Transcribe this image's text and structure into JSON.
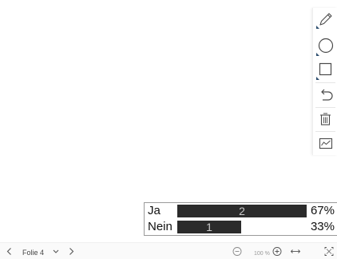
{
  "toolbar": {
    "tools": [
      {
        "name": "pencil-tool",
        "icon": "pencil-icon",
        "has_submenu": true
      },
      {
        "name": "ellipse-tool",
        "icon": "circle-icon",
        "has_submenu": true
      },
      {
        "name": "rectangle-tool",
        "icon": "square-icon",
        "has_submenu": true
      },
      {
        "name": "undo-tool",
        "icon": "undo-icon",
        "has_submenu": false
      },
      {
        "name": "delete-tool",
        "icon": "trash-icon",
        "has_submenu": false
      },
      {
        "name": "chart-tool",
        "icon": "line-chart-icon",
        "has_submenu": false
      }
    ]
  },
  "results": {
    "rows": [
      {
        "label": "Ja",
        "count": "2",
        "percent": "67%",
        "fraction": 0.67
      },
      {
        "label": "Nein",
        "count": "1",
        "percent": "33%",
        "fraction": 0.33
      }
    ],
    "bar_color": "#2b2b2b"
  },
  "bottombar": {
    "prev_icon": "chevron-left-icon",
    "slide_label": "Folie 4",
    "slide_dropdown_icon": "chevron-down-icon",
    "next_icon": "chevron-right-icon",
    "zoom_out_icon": "zoom-out-icon",
    "zoom_level": "100 %",
    "zoom_in_icon": "zoom-in-icon",
    "fit_width_icon": "fit-width-icon",
    "fullscreen_icon": "fullscreen-icon"
  },
  "colors": {
    "icon_stroke": "#4a4a4a",
    "toolbar_bg": "#ffffff",
    "bottombar_bg": "#fafafa"
  }
}
